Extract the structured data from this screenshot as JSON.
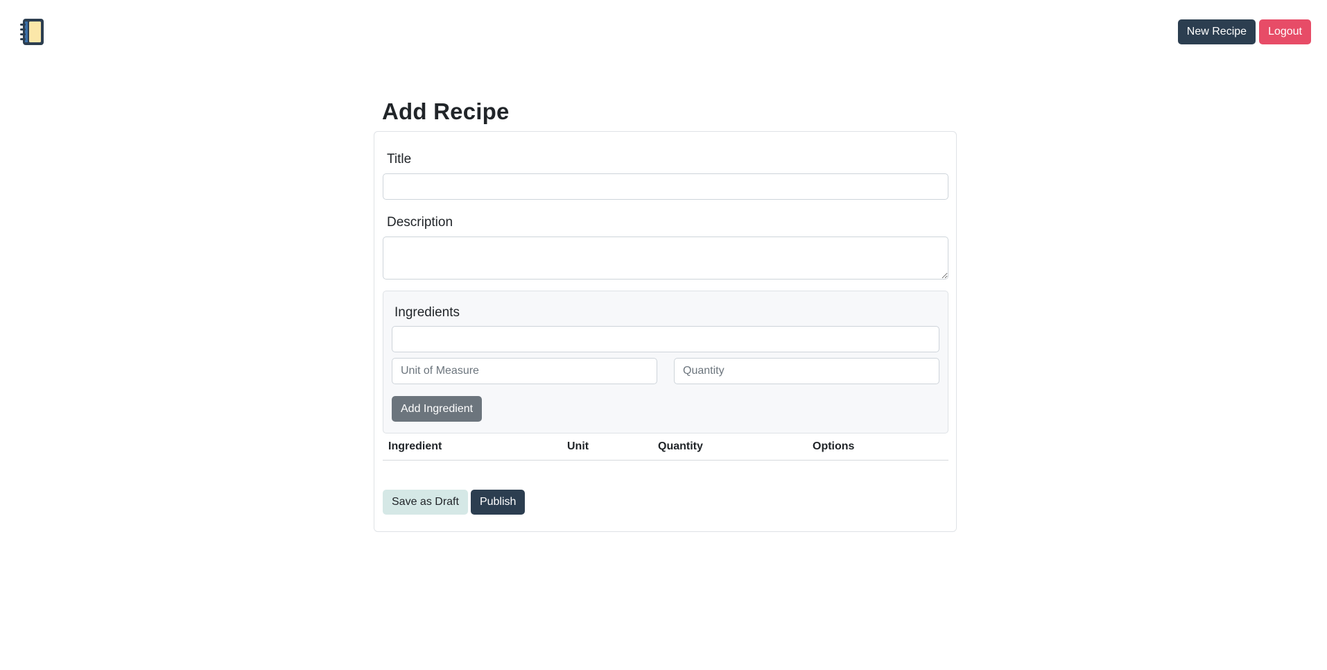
{
  "navbar": {
    "logo_icon": "notebook-icon",
    "new_recipe_label": "New Recipe",
    "logout_label": "Logout"
  },
  "page": {
    "title": "Add Recipe"
  },
  "form": {
    "title_label": "Title",
    "title_value": "",
    "description_label": "Description",
    "description_value": "",
    "ingredients": {
      "section_label": "Ingredients",
      "ingredient_value": "",
      "unit_placeholder": "Unit of Measure",
      "quantity_placeholder": "Quantity",
      "add_button_label": "Add Ingredient"
    },
    "table": {
      "headers": [
        "Ingredient",
        "Unit",
        "Quantity",
        "Options"
      ],
      "rows": []
    },
    "save_draft_label": "Save as Draft",
    "publish_label": "Publish"
  },
  "colors": {
    "primary_dark": "#2c3e50",
    "danger": "#e74c67",
    "secondary": "#6c757d",
    "light_teal": "#d5e8e6"
  }
}
